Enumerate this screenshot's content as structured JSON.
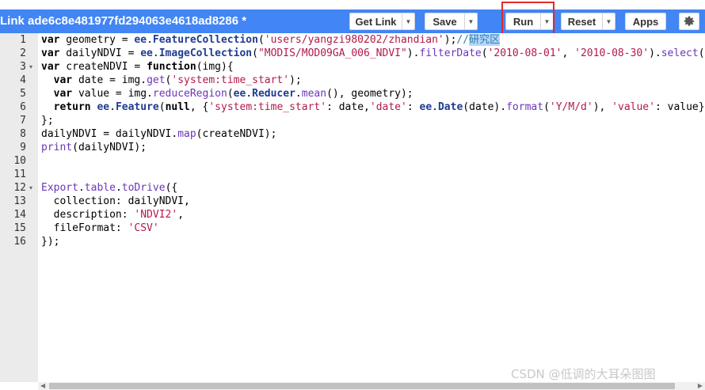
{
  "toolbar": {
    "title": "Link ade6c8e481977fd294063e4618ad8286 *",
    "buttons": {
      "get_link": "Get Link",
      "save": "Save",
      "run": "Run",
      "reset": "Reset",
      "apps": "Apps"
    },
    "colors": {
      "background": "#4285f4",
      "highlight": "#e8262b"
    }
  },
  "editor": {
    "line_numbers": [
      "1",
      "2",
      "3",
      "4",
      "5",
      "6",
      "7",
      "8",
      "9",
      "10",
      "11",
      "12",
      "13",
      "14",
      "15",
      "16"
    ],
    "fold_markers": {
      "3": "▾",
      "12": "▾"
    },
    "lines": [
      [
        [
          "kw",
          "var"
        ],
        [
          "v",
          " geometry = "
        ],
        [
          "ns",
          "ee"
        ],
        [
          "v",
          "."
        ],
        [
          "ns",
          "FeatureCollection"
        ],
        [
          "v",
          "("
        ],
        [
          "s",
          "'users/yangzi980202/zhandian'"
        ],
        [
          "v",
          ");"
        ],
        [
          "c",
          "//"
        ],
        [
          "cjk",
          "研究区"
        ]
      ],
      [
        [
          "kw",
          "var"
        ],
        [
          "v",
          " dailyNDVI = "
        ],
        [
          "ns",
          "ee"
        ],
        [
          "v",
          "."
        ],
        [
          "ns",
          "ImageCollection"
        ],
        [
          "v",
          "("
        ],
        [
          "s",
          "\"MODIS/MOD09GA_006_NDVI\""
        ],
        [
          "v",
          ")."
        ],
        [
          "m",
          "filterDate"
        ],
        [
          "v",
          "("
        ],
        [
          "s",
          "'2010-08-01'"
        ],
        [
          "v",
          ", "
        ],
        [
          "s",
          "'2010-08-30'"
        ],
        [
          "v",
          ")."
        ],
        [
          "m",
          "select"
        ],
        [
          "v",
          "("
        ]
      ],
      [
        [
          "kw",
          "var"
        ],
        [
          "v",
          " createNDVI = "
        ],
        [
          "kw",
          "function"
        ],
        [
          "v",
          "(img){"
        ]
      ],
      [
        [
          "v",
          "  "
        ],
        [
          "kw",
          "var"
        ],
        [
          "v",
          " date = img."
        ],
        [
          "m",
          "get"
        ],
        [
          "v",
          "("
        ],
        [
          "s",
          "'system:time_start'"
        ],
        [
          "v",
          ");"
        ]
      ],
      [
        [
          "v",
          "  "
        ],
        [
          "kw",
          "var"
        ],
        [
          "v",
          " value = img."
        ],
        [
          "m",
          "reduceRegion"
        ],
        [
          "v",
          "("
        ],
        [
          "ns",
          "ee"
        ],
        [
          "v",
          "."
        ],
        [
          "ns",
          "Reducer"
        ],
        [
          "v",
          "."
        ],
        [
          "m",
          "mean"
        ],
        [
          "v",
          "(), geometry);"
        ]
      ],
      [
        [
          "v",
          "  "
        ],
        [
          "kw",
          "return"
        ],
        [
          "v",
          " "
        ],
        [
          "ns",
          "ee"
        ],
        [
          "v",
          "."
        ],
        [
          "ns",
          "Feature"
        ],
        [
          "v",
          "("
        ],
        [
          "kw",
          "null"
        ],
        [
          "v",
          ", {"
        ],
        [
          "s",
          "'system:time_start'"
        ],
        [
          "v",
          ": date,"
        ],
        [
          "s",
          "'date'"
        ],
        [
          "v",
          ": "
        ],
        [
          "ns",
          "ee"
        ],
        [
          "v",
          "."
        ],
        [
          "ns",
          "Date"
        ],
        [
          "v",
          "(date)."
        ],
        [
          "m",
          "format"
        ],
        [
          "v",
          "("
        ],
        [
          "s",
          "'Y/M/d'"
        ],
        [
          "v",
          "), "
        ],
        [
          "s",
          "'value'"
        ],
        [
          "v",
          ": value}"
        ]
      ],
      [
        [
          "v",
          "};"
        ]
      ],
      [
        [
          "v",
          "dailyNDVI = dailyNDVI."
        ],
        [
          "m",
          "map"
        ],
        [
          "v",
          "(createNDVI);"
        ]
      ],
      [
        [
          "m",
          "print"
        ],
        [
          "v",
          "(dailyNDVI);"
        ]
      ],
      [
        [
          "v",
          ""
        ]
      ],
      [
        [
          "v",
          ""
        ]
      ],
      [
        [
          "m",
          "Export"
        ],
        [
          "v",
          "."
        ],
        [
          "m",
          "table"
        ],
        [
          "v",
          "."
        ],
        [
          "m",
          "toDrive"
        ],
        [
          "v",
          "({"
        ]
      ],
      [
        [
          "v",
          "  collection: dailyNDVI,"
        ]
      ],
      [
        [
          "v",
          "  description: "
        ],
        [
          "s",
          "'NDVI2'"
        ],
        [
          "v",
          ","
        ]
      ],
      [
        [
          "v",
          "  fileFormat: "
        ],
        [
          "s",
          "'CSV'"
        ]
      ],
      [
        [
          "v",
          "});"
        ]
      ]
    ]
  },
  "scrollbar": {
    "left_arrow": "◀",
    "right_arrow": "▶"
  },
  "watermark": "CSDN @低调的大耳朵图图",
  "icons": {
    "settings": "gear-icon",
    "dropdown": "caret-down-icon"
  }
}
